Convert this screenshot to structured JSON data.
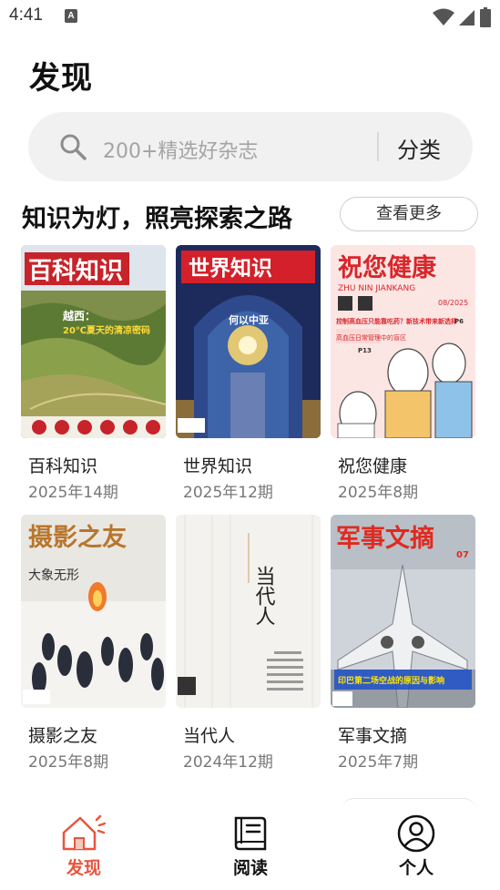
{
  "status_bar": {
    "time": "4:41",
    "notification_glyph": "A"
  },
  "page_title": "发现",
  "search": {
    "placeholder": "200+精选好杂志",
    "category_label": "分类"
  },
  "section": {
    "title": "知识为灯，照亮探索之路",
    "see_more": "查看更多"
  },
  "magazines": [
    {
      "name": "百科知识",
      "issue": "2025年14期",
      "cover_title": "百科知识",
      "cover_headline_1": "越西：",
      "cover_headline_2": "20℃夏天的清凉密码",
      "cover_color": "#c7232a"
    },
    {
      "name": "世界知识",
      "issue": "2025年12期",
      "cover_title": "世界知识",
      "cover_headline_1": "何以中亚",
      "cover_color": "#d4202a"
    },
    {
      "name": "祝您健康",
      "issue": "2025年8期",
      "cover_title": "祝您健康",
      "cover_subtitle": "ZHU NIN JIANKANG",
      "cover_issue": "08/2025",
      "cover_headline_1": "控制高血压只能靠吃药？新技术带来新选择",
      "cover_page_1": "P6",
      "cover_headline_2": "高血压日常管理中的盲区",
      "cover_page_2": "P13",
      "cover_color": "#d9262b"
    },
    {
      "name": "摄影之友",
      "issue": "2025年8期",
      "cover_title": "摄影之友",
      "cover_headline_1": "大象无形",
      "cover_color": "#f1eee8"
    },
    {
      "name": "当代人",
      "issue": "2024年12期",
      "cover_title": "当代人",
      "cover_color": "#f4f2ee"
    },
    {
      "name": "军事文摘",
      "issue": "2025年7期",
      "cover_title": "军事文摘",
      "cover_issue": "07",
      "cover_headline_1": "印巴第二场空战的原因与影响",
      "cover_color": "#e02a20"
    }
  ],
  "nav": [
    {
      "label": "发现",
      "icon": "home-icon",
      "active": true,
      "color": "#e8553e"
    },
    {
      "label": "阅读",
      "icon": "book-icon",
      "active": false,
      "color": "#111111"
    },
    {
      "label": "个人",
      "icon": "profile-icon",
      "active": false,
      "color": "#111111"
    }
  ]
}
